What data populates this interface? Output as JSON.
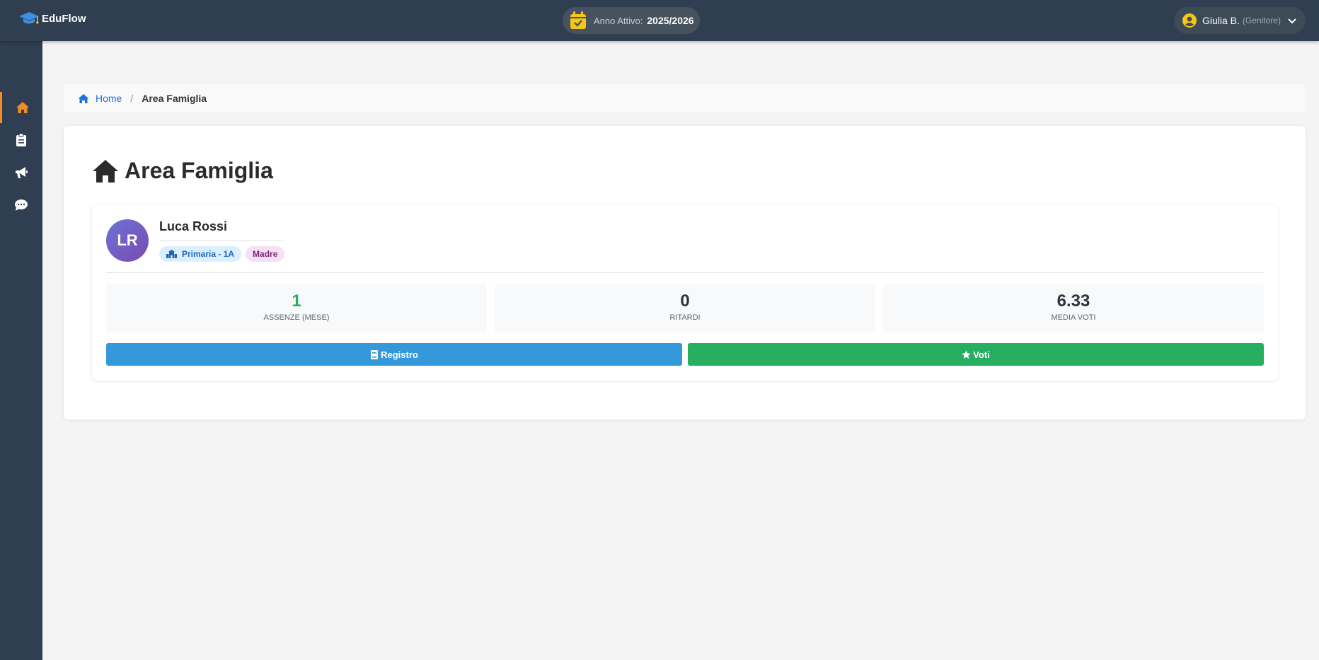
{
  "app": {
    "brand": "EduFlow"
  },
  "header": {
    "year_label": "Anno Attivo:",
    "year_value": "2025/2026",
    "user_name": "Giulia B.",
    "user_role": "(Genitore)"
  },
  "sidebar": {
    "items": [
      {
        "icon": "home-icon",
        "active": true
      },
      {
        "icon": "clipboard-icon",
        "active": false
      },
      {
        "icon": "megaphone-icon",
        "active": false
      },
      {
        "icon": "chat-icon",
        "active": false
      }
    ]
  },
  "breadcrumb": {
    "home": "Home",
    "separator": "/",
    "current": "Area Famiglia"
  },
  "page": {
    "title": "Area Famiglia"
  },
  "student": {
    "initials": "LR",
    "name": "Luca Rossi",
    "class_badge": "Primaria - 1A",
    "relation_badge": "Madre",
    "stats": [
      {
        "value": "1",
        "label": "ASSENZE (MESE)"
      },
      {
        "value": "0",
        "label": "RITARDI"
      },
      {
        "value": "6.33",
        "label": "MEDIA VOTI"
      }
    ],
    "buttons": {
      "registro": "Registro",
      "voti": "Voti"
    }
  },
  "colors": {
    "topbar": "#2f3e50",
    "accent": "#f28b2c",
    "blue": "#3498db",
    "green": "#27ae60",
    "link": "#1f72d8"
  }
}
